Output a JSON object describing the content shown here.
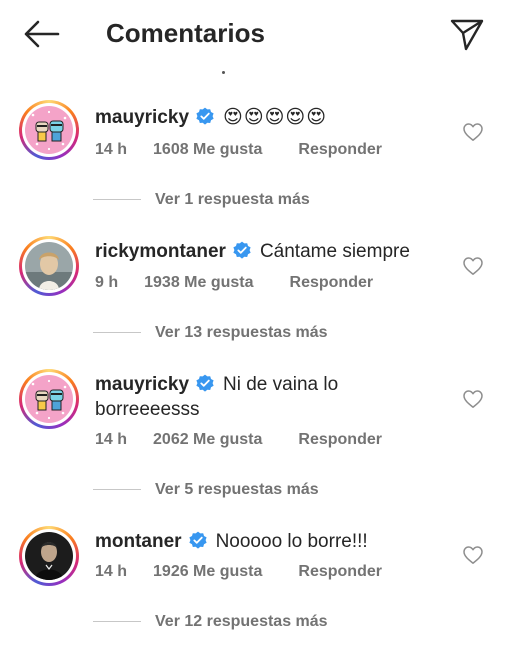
{
  "header": {
    "title": "Comentarios"
  },
  "icons": {
    "back": "arrow-left-icon",
    "send": "paper-plane-icon",
    "like": "heart-outline-icon",
    "verified": "verified-badge-icon"
  },
  "colors": {
    "verified": "#3897f0",
    "meta": "#737373",
    "text": "#262626"
  },
  "comments": [
    {
      "username": "mauyricky",
      "text": "😍😍😍😍😍",
      "time": "14 h",
      "likes": "1608 Me gusta",
      "reply": "Responder",
      "view_replies": "Ver 1 respuesta más"
    },
    {
      "username": "rickymontaner",
      "text": "Cántame siempre",
      "time": "9 h",
      "likes": "1938 Me gusta",
      "reply": "Responder",
      "view_replies": "Ver 13 respuestas más"
    },
    {
      "username": "mauyricky",
      "text": "Ni de vaina lo",
      "text2": "borreeeesss",
      "time": "14 h",
      "likes": "2062 Me gusta",
      "reply": "Responder",
      "view_replies": "Ver 5 respuestas más"
    },
    {
      "username": "montaner",
      "text": "Nooooo lo borre!!!",
      "time": "14 h",
      "likes": "1926 Me gusta",
      "reply": "Responder",
      "view_replies": "Ver 12 respuestas más"
    }
  ]
}
